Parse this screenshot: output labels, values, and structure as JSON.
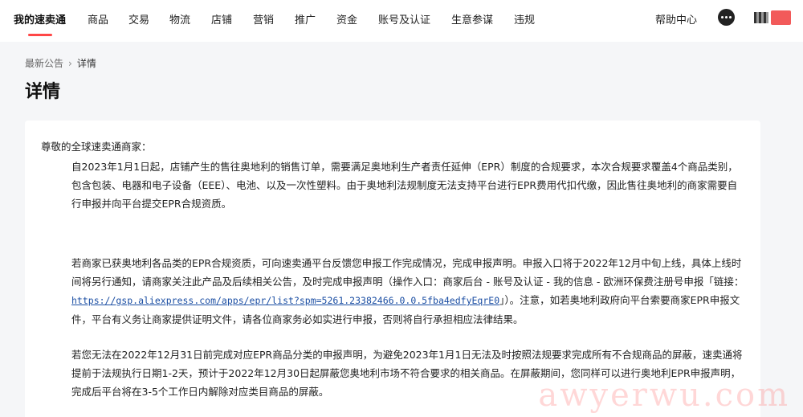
{
  "nav": {
    "items": [
      {
        "label": "我的速卖通",
        "active": true
      },
      {
        "label": "商品"
      },
      {
        "label": "交易"
      },
      {
        "label": "物流"
      },
      {
        "label": "店铺"
      },
      {
        "label": "营销"
      },
      {
        "label": "推广"
      },
      {
        "label": "资金"
      },
      {
        "label": "账号及认证"
      },
      {
        "label": "生意参谋"
      },
      {
        "label": "违规"
      }
    ],
    "help": "帮助中心",
    "accent_color": "#ff4747"
  },
  "breadcrumb": {
    "parent": "最新公告",
    "separator": "›",
    "current": "详情"
  },
  "page_title": "详情",
  "article": {
    "greeting": "尊敬的全球速卖通商家：",
    "p1": "自2023年1月1日起，店铺产生的售往奥地利的销售订单，需要满足奥地利生产者责任延伸（EPR）制度的合规要求，本次合规要求覆盖4个商品类别，包含包装、电器和电子设备（EEE）、电池、以及一次性塑料。由于奥地利法规制度无法支持平台进行EPR费用代扣代缴，因此售往奥地利的商家需要自行申报并向平台提交EPR合规资质。",
    "p2_before": "若商家已获奥地利各品类的EPR合规资质，可向速卖通平台反馈您申报工作完成情况，完成申报声明。申报入口将于2022年12月中旬上线，具体上线时间将另行通知，请商家关注此产品及后续相关公告，及时完成申报声明（操作入口：商家后台 - 账号及认证 - 我的信息 - 欧洲环保费注册号申报「链接：",
    "p2_link": "https://gsp.aliexpress.com/apps/epr/list?spm=5261.23382466.0.0.5fba4edfyEqrE0",
    "p2_after": "」）。注意，如若奥地利政府向平台索要商家EPR申报文件，平台有义务让商家提供证明文件，请各位商家务必如实进行申报，否则将自行承担相应法律结果。",
    "p3": "若您无法在2022年12月31日前完成对应EPR商品分类的申报声明，为避免2023年1月1日无法及时按照法规要求完成所有不合规商品的屏蔽，速卖通将提前于法规执行日期1-2天，预计于2022年12月30日起屏蔽您奥地利市场不符合要求的相关商品。在屏蔽期间，您同样可以进行奥地利EPR申报声明，完成后平台将在3-5个工作日内解除对应类目商品的屏蔽。"
  },
  "watermark": "awyerwu.com"
}
